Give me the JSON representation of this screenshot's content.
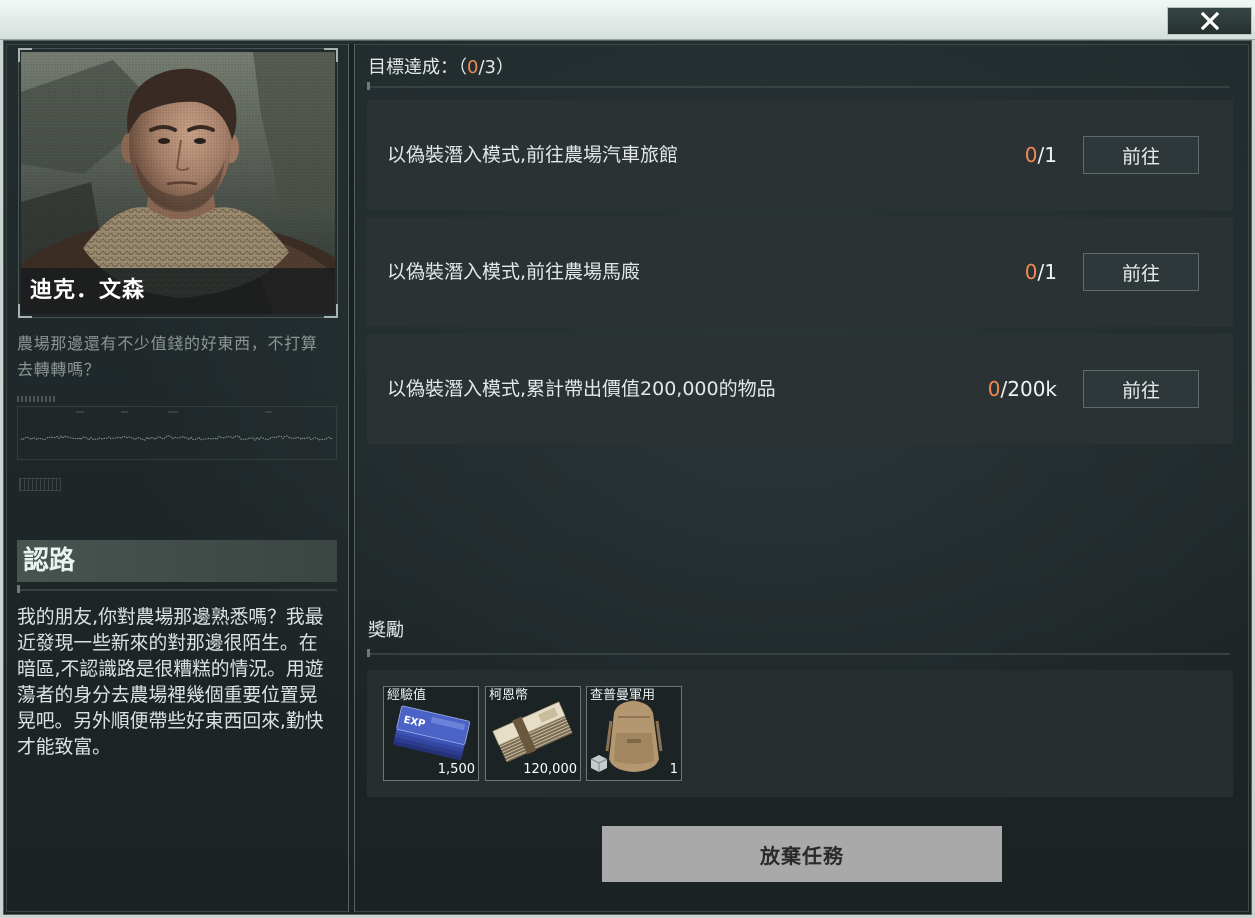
{
  "window": {
    "close_icon": "close-icon"
  },
  "character": {
    "name": "迪克．文森",
    "portrait_icon": "character-portrait",
    "greeting": "農場那邊還有不少值錢的好東西，不打算去轉轉嗎？"
  },
  "quest": {
    "title": "認路",
    "description": "我的朋友,你對農場那邊熟悉嗎？我最近發現一些新來的對那邊很陌生。在暗區,不認識路是很糟糕的情況。用遊蕩者的身分去農場裡幾個重要位置晃晃吧。另外順便帶些好東西回來,勤快才能致富。"
  },
  "objectives": {
    "label": "目標達成：",
    "progress_open": "（",
    "progress_done": "0",
    "progress_rest": "/3）",
    "items": [
      {
        "text": "以偽裝潛入模式,前往農場汽車旅館",
        "progress_done": "0",
        "progress_rest": "/1",
        "button_label": "前往"
      },
      {
        "text": "以偽裝潛入模式,前往農場馬廄",
        "progress_done": "0",
        "progress_rest": "/1",
        "button_label": "前往"
      },
      {
        "text": "以偽裝潛入模式,累計帶出價值200,000的物品",
        "progress_done": "0",
        "progress_rest": "/200k",
        "button_label": "前往"
      }
    ]
  },
  "rewards": {
    "label": "獎勵",
    "items": [
      {
        "name": "經驗值",
        "count": "1,500",
        "icon": "exp-ticket-icon",
        "icon_text": "EXP"
      },
      {
        "name": "柯恩幣",
        "count": "120,000",
        "icon": "banknote-stack-icon"
      },
      {
        "name": "查普曼軍用",
        "count": "1",
        "icon": "backpack-icon",
        "badge_icon": "container-icon"
      }
    ]
  },
  "actions": {
    "abandon_label": "放棄任務"
  },
  "colors": {
    "accent_progress": "#f08a55",
    "panel_bg": "#212a2c",
    "row_bg": "#2a3234",
    "text_primary": "#e0e5e4",
    "text_muted": "#8c9595",
    "abandon_button_bg": "#a9a9a9"
  }
}
